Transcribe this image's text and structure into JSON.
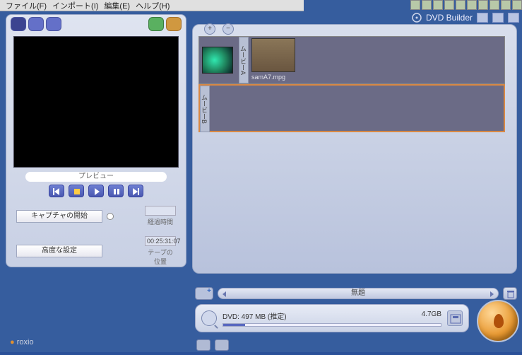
{
  "menu": {
    "file": "ファイル(F)",
    "import": "インポート(I)",
    "edit": "編集(E)",
    "help": "ヘルプ(H)"
  },
  "title": "DVD Builder",
  "preview": {
    "label": "プレビュー"
  },
  "capture": {
    "start_label": "キャプチャの開始",
    "elapsed_label": "経過時間",
    "advanced_label": "高度な設定",
    "tape_label": "テープの位置",
    "tape_value": "00:25:31:07"
  },
  "tracks": {
    "a_label": "ムービーA",
    "b_label": "ムービーB"
  },
  "clip": {
    "filename": "samA7.mpg"
  },
  "footer": {
    "menu_title": "無題",
    "disc_text": "DVD: 497 MB (推定)",
    "disc_cap": "4.7GB"
  },
  "brand": {
    "name": "roxio"
  }
}
